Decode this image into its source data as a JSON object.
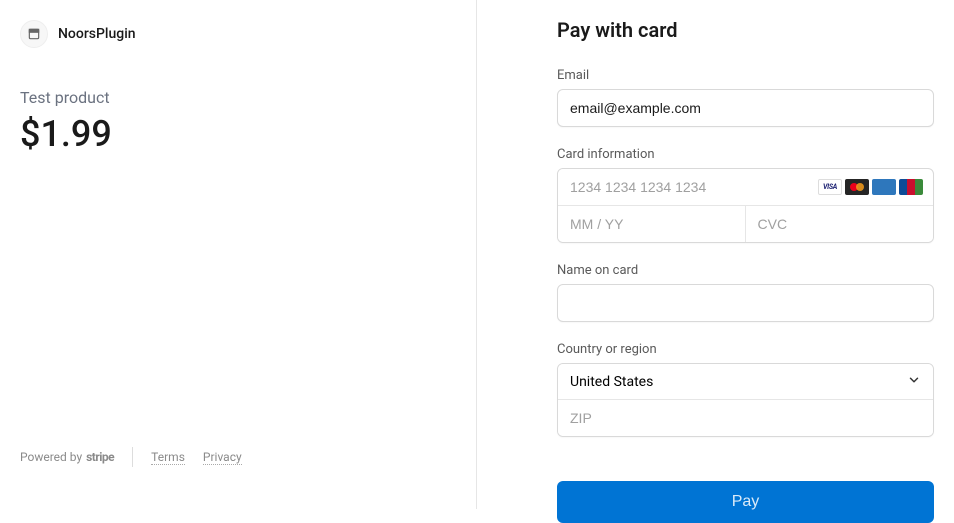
{
  "merchant": {
    "name": "NoorsPlugin"
  },
  "product": {
    "name": "Test product",
    "price": "$1.99"
  },
  "footer": {
    "powered_by_prefix": "Powered by",
    "powered_by_brand": "stripe",
    "terms_label": "Terms",
    "privacy_label": "Privacy"
  },
  "form": {
    "title": "Pay with card",
    "email_label": "Email",
    "email_value": "email@example.com",
    "card_label": "Card information",
    "card_number_placeholder": "1234 1234 1234 1234",
    "expiry_placeholder": "MM / YY",
    "cvc_placeholder": "CVC",
    "name_label": "Name on card",
    "name_value": "",
    "country_label": "Country or region",
    "country_selected": "United States",
    "zip_placeholder": "ZIP",
    "pay_button_label": "Pay"
  },
  "card_brands": [
    "visa",
    "mastercard",
    "amex",
    "jcb"
  ]
}
